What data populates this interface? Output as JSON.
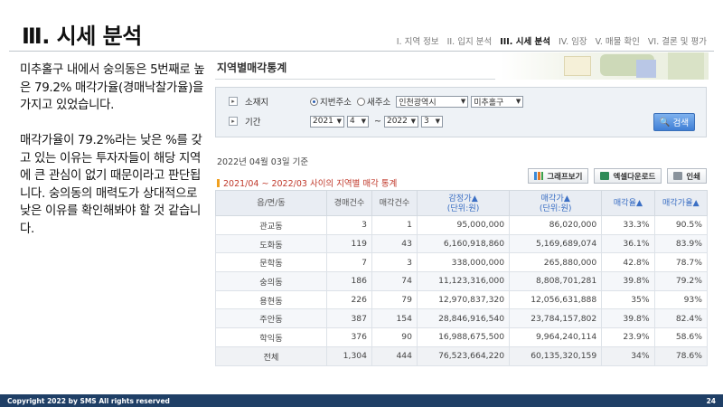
{
  "slide": {
    "title": "Ⅲ. 시세 분석",
    "nav": [
      {
        "label": "I. 지역 정보",
        "active": false
      },
      {
        "label": "II. 입지 분석",
        "active": false
      },
      {
        "label": "III. 시세 분석",
        "active": true
      },
      {
        "label": "IV. 임장",
        "active": false
      },
      {
        "label": "V. 매물 확인",
        "active": false
      },
      {
        "label": "VI. 결론 및 평가",
        "active": false
      }
    ],
    "paragraphs": [
      "미추홀구 내에서 숭의동은 5번째로 높은 79.2% 매각가율(경매낙찰가율)을 가지고 있었습니다.",
      "매각가율이 79.2%라는 낮은 %를 갖고 있는 이유는 투자자들이 해당 지역에 큰 관심이 없기 때문이라고 판단됩니다. 숭의동의 매력도가 상대적으로 낮은 이유를 확인해봐야 할 것 같습니다."
    ],
    "footer": {
      "copyright": "Copyright 2022 by SMS All rights reserved",
      "page": "24"
    }
  },
  "screenshot": {
    "title": "지역별매각통계",
    "search": {
      "location_label": "소재지",
      "radio_lot": "지번주소",
      "radio_road": "새주소",
      "city": "인천광역시",
      "district": "미추홀구",
      "period_label": "기간",
      "from_year": "2021",
      "from_month": "4",
      "tilde": "~",
      "to_year": "2022",
      "to_month": "3",
      "search_button": "검색"
    },
    "as_of": "2022년 04월 03일 기준",
    "period_heading": "2021/04 ~ 2022/03 사이의 지역별 매각 통계",
    "buttons": {
      "graph": "그래프보기",
      "excel": "엑셀다운로드",
      "print": "인쇄"
    },
    "table": {
      "headers": [
        "읍/면/동",
        "경매건수",
        "매각건수",
        "감정가▲",
        "(단위:원)",
        "매각가▲",
        "(단위:원)",
        "매각율▲",
        "매각가율▲"
      ],
      "rows": [
        [
          "관교동",
          "3",
          "1",
          "95,000,000",
          "86,020,000",
          "33.3%",
          "90.5%"
        ],
        [
          "도화동",
          "119",
          "43",
          "6,160,918,860",
          "5,169,689,074",
          "36.1%",
          "83.9%"
        ],
        [
          "문학동",
          "7",
          "3",
          "338,000,000",
          "265,880,000",
          "42.8%",
          "78.7%"
        ],
        [
          "숭의동",
          "186",
          "74",
          "11,123,316,000",
          "8,808,701,281",
          "39.8%",
          "79.2%"
        ],
        [
          "용현동",
          "226",
          "79",
          "12,970,837,320",
          "12,056,631,888",
          "35%",
          "93%"
        ],
        [
          "주안동",
          "387",
          "154",
          "28,846,916,540",
          "23,784,157,802",
          "39.8%",
          "82.4%"
        ],
        [
          "학익동",
          "376",
          "90",
          "16,988,675,500",
          "9,964,240,114",
          "23.9%",
          "58.6%"
        ],
        [
          "전체",
          "1,304",
          "444",
          "76,523,664,220",
          "60,135,320,159",
          "34%",
          "78.6%"
        ]
      ]
    }
  },
  "colors": {
    "footer_bg": "#1f3f66",
    "accent_blue": "#3b6fc4",
    "period_red": "#c0392b",
    "search_btn": "#3f7fd6"
  }
}
